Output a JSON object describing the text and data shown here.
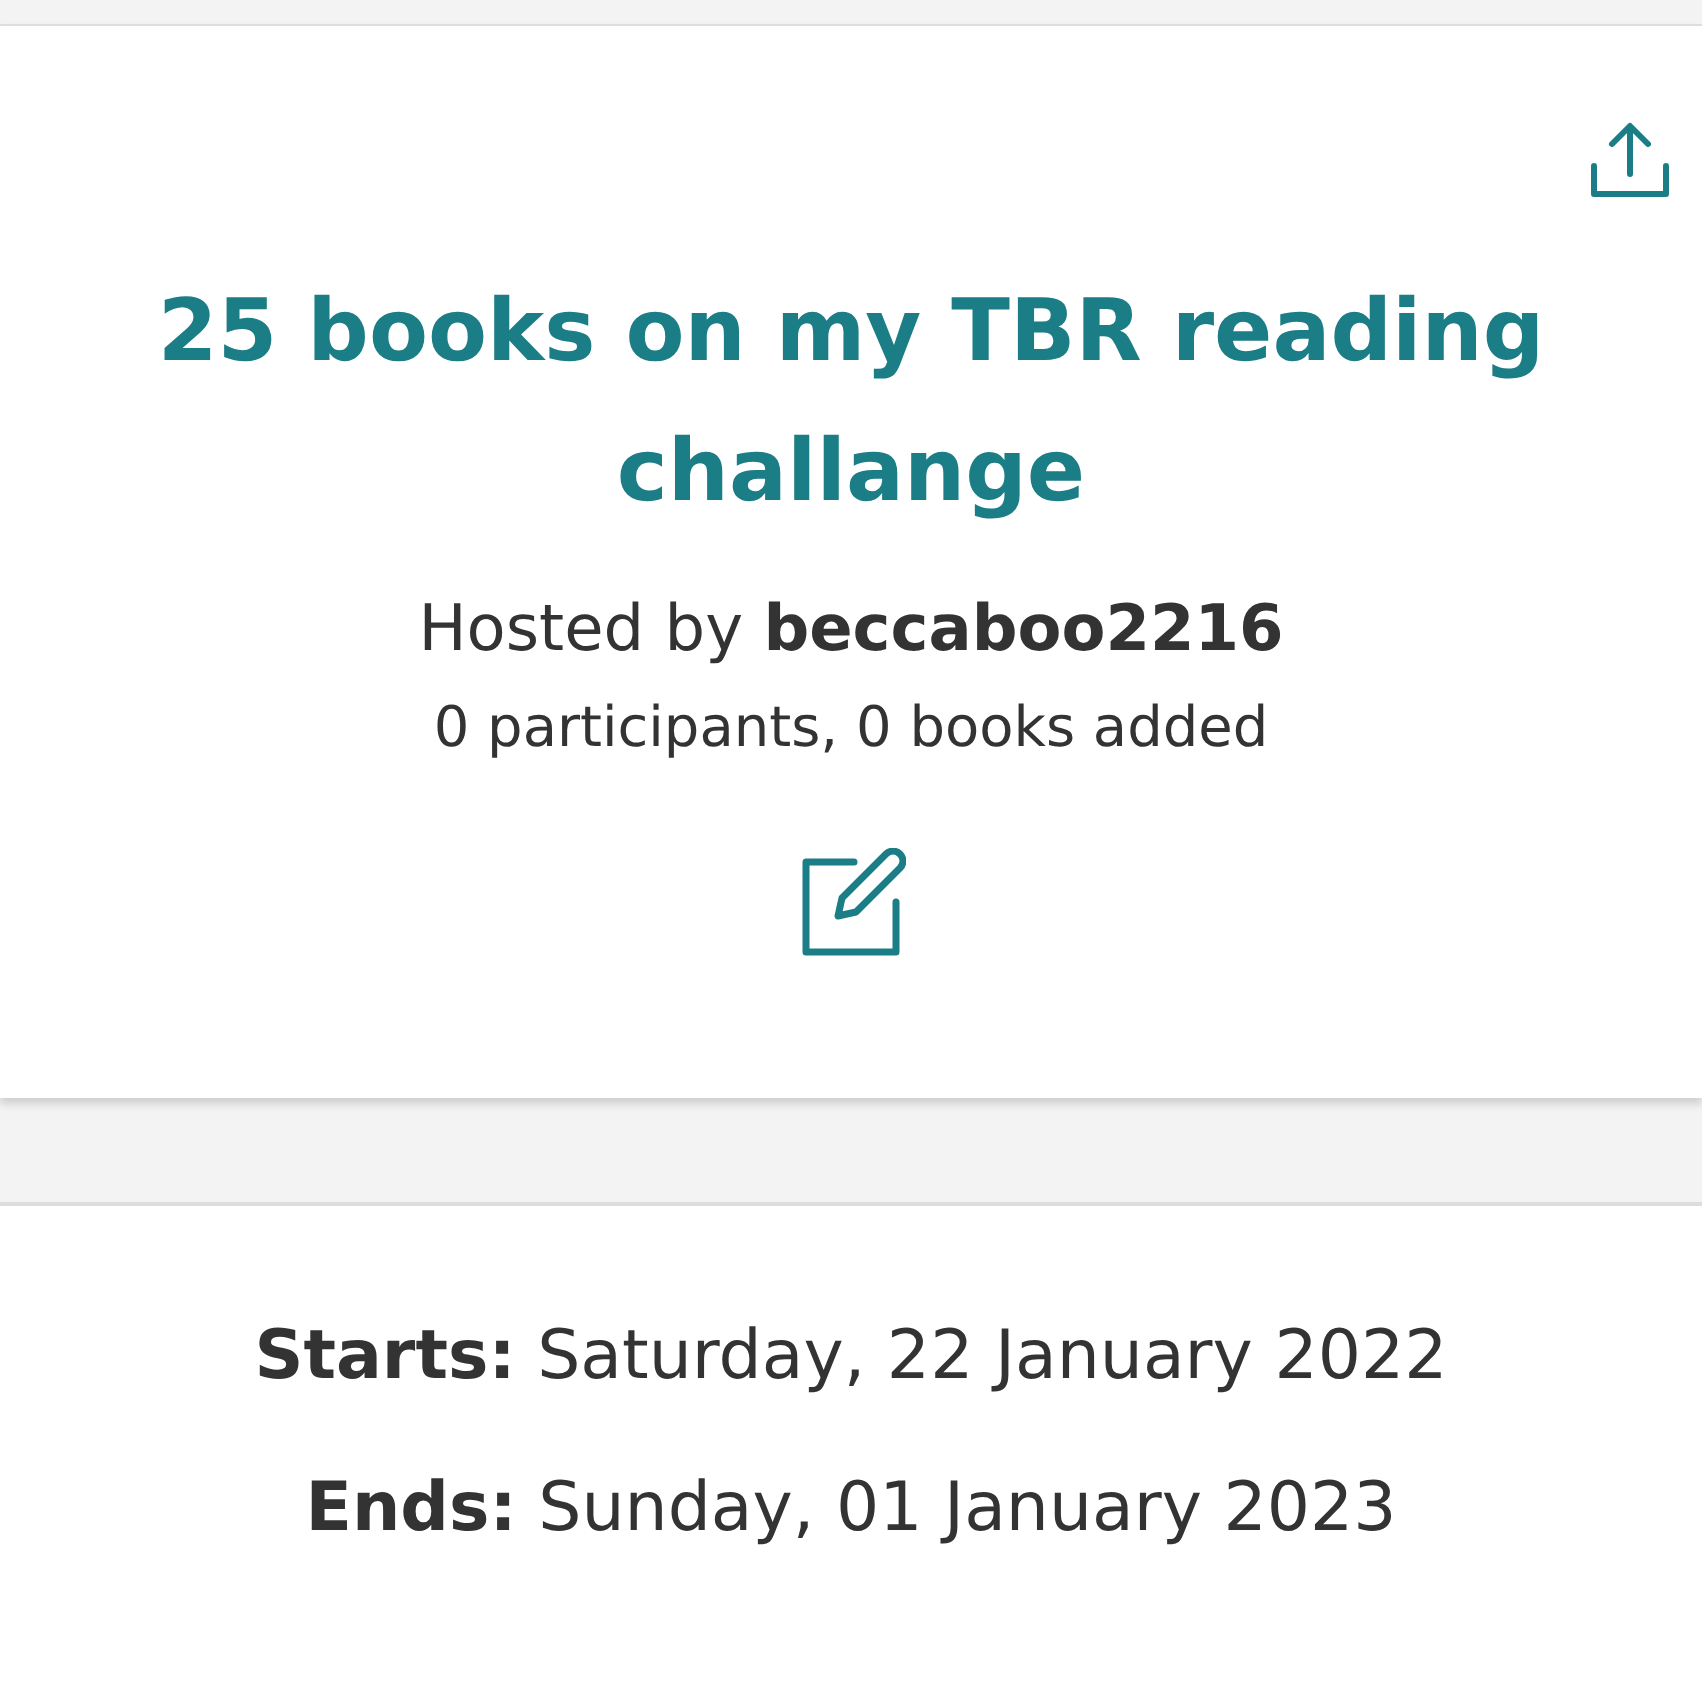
{
  "challenge": {
    "title": "25 books on my TBR reading challange",
    "host": "Hosted by **beccaboo2216**",
    "stats": "0 participants, 0 books added"
  },
  "dates": [
    "**Starts:** Saturday, 22 January 2022",
    "**Ends:** Sunday, 01 January 2023"
  ]
}
